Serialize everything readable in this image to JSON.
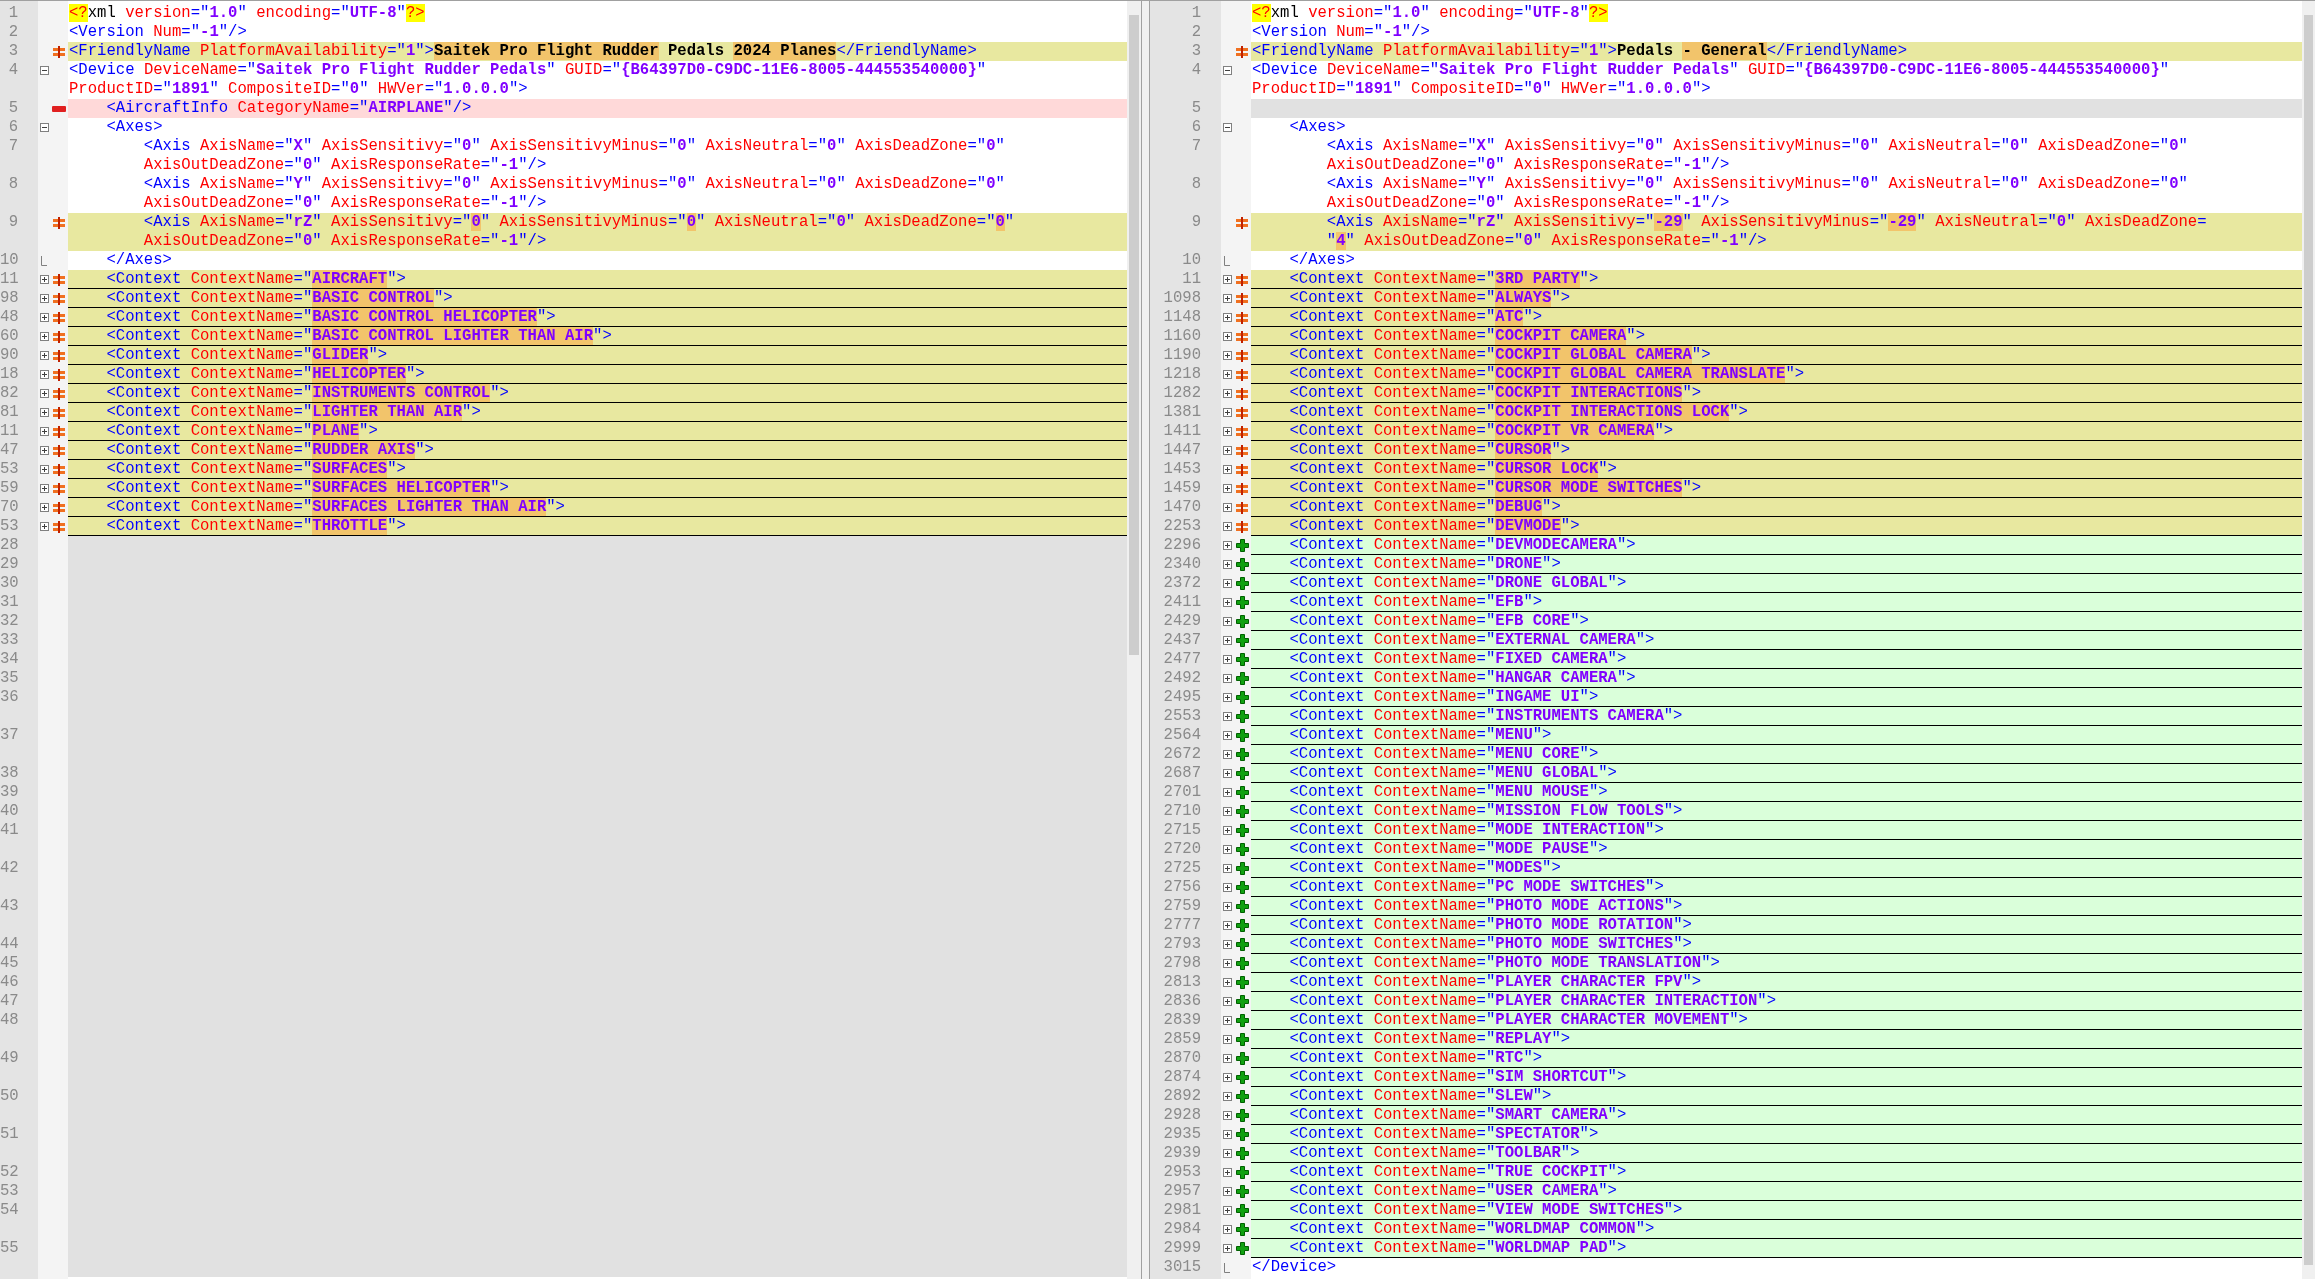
{
  "left_pane": {
    "lines": [
      {
        "number": "1",
        "visual_lines": [
          {
            "parts": [
              "<?xml version=\"1.0\" encoding=\"UTF-8\"?>"
            ]
          }
        ]
      },
      {
        "number": "2",
        "visual_lines": [
          {
            "parts": [
              "<Version Num=\"-1\"/>"
            ]
          }
        ]
      },
      {
        "number": "3",
        "kind": "changed",
        "visual_lines": [
          {
            "parts": [
              "<FriendlyName PlatformAvailability=\"1\">",
              {
                "text": "Saitek Pro Flight Rudder",
                "changed": true
              },
              " Pedals ",
              {
                "text": "2024 Planes",
                "changed": true
              },
              "</FriendlyName>"
            ]
          }
        ]
      },
      {
        "number": "4",
        "expanded": true,
        "visual_lines": [
          {
            "parts": [
              "<Device DeviceName=\"Saitek Pro Flight Rudder Pedals\" GUID=\"{B64397D0-C9DC-11E6-8005-444553540000}\""
            ]
          },
          {
            "parts": [
              "ProductID=\"1891\" CompositeID=\"0\" HWVer=\"1.0.0.0\">"
            ]
          }
        ],
        "children": [
          {
            "number": "5",
            "kind": "removed",
            "visual_lines": [
              {
                "parts": [
                  "<AircraftInfo CategoryName=\"AIRPLANE\"/>"
                ]
              }
            ]
          },
          {
            "number": "6",
            "expanded": true,
            "visual_lines": [
              {
                "parts": [
                  "<Axes>"
                ]
              }
            ],
            "children": [
              {
                "number": "7",
                "visual_lines": [
                  {
                    "parts": [
                      "<Axis AxisName=\"X\" AxisSensitivy=\"0\" AxisSensitivyMinus=\"0\" AxisNeutral=\"0\" AxisDeadZone=\"0\""
                    ]
                  },
                  {
                    "parts": [
                      "AxisOutDeadZone=\"0\" AxisResponseRate=\"-1\"/>"
                    ]
                  }
                ]
              },
              {
                "number": "8",
                "visual_lines": [
                  {
                    "parts": [
                      "<Axis AxisName=\"Y\" AxisSensitivy=\"0\" AxisSensitivyMinus=\"0\" AxisNeutral=\"0\" AxisDeadZone=\"0\""
                    ]
                  },
                  {
                    "parts": [
                      "AxisOutDeadZone=\"0\" AxisResponseRate=\"-1\"/>"
                    ]
                  }
                ]
              },
              {
                "number": "9",
                "kind": "changed",
                "visual_lines": [
                  {
                    "parts": [
                      "<Axis AxisName=\"rZ\" AxisSensitivy=\"",
                      {
                        "text": "0",
                        "changed": true
                      },
                      "\" AxisSensitivyMinus=\"",
                      {
                        "text": "0",
                        "changed": true
                      },
                      "\" AxisNeutral=\"0\" AxisDeadZone=\"",
                      {
                        "text": "0",
                        "changed": true
                      },
                      "\""
                    ]
                  },
                  {
                    "parts": [
                      "AxisOutDeadZone=\"0\" AxisResponseRate=\"-1\"/>"
                    ]
                  }
                ]
              }
            ],
            "closing": {
              "number": "10",
              "visual_lines": [
                {
                  "parts": [
                    "</Axes>"
                  ]
                }
              ]
            }
          },
          {
            "number": "11",
            "kind": "changed",
            "expanded": false,
            "visual_lines": [
              {
                "parts": [
                  "<Context ContextName=\"",
                  {
                    "text": "AIRCRAFT",
                    "changed": true
                  },
                  "\">"
                ]
              }
            ]
          },
          {
            "number": "98",
            "kind": "changed",
            "expanded": false,
            "visual_lines": [
              {
                "parts": [
                  "<Context ContextName=\"",
                  {
                    "text": "BASIC CONTROL",
                    "changed": true
                  },
                  "\">"
                ]
              }
            ]
          },
          {
            "number": "48",
            "kind": "changed",
            "expanded": false,
            "visual_lines": [
              {
                "parts": [
                  "<Context ContextName=\"",
                  {
                    "text": "BASIC CONTROL HELICOPTER",
                    "changed": true
                  },
                  "\">"
                ]
              }
            ]
          },
          {
            "number": "60",
            "kind": "changed",
            "expanded": false,
            "visual_lines": [
              {
                "parts": [
                  "<Context ContextName=\"",
                  {
                    "text": "BASIC CONTROL LIGHTER THAN AIR",
                    "changed": true
                  },
                  "\">"
                ]
              }
            ]
          },
          {
            "number": "90",
            "kind": "changed",
            "expanded": false,
            "visual_lines": [
              {
                "parts": [
                  "<Context ContextName=\"",
                  {
                    "text": "GLIDER",
                    "changed": true
                  },
                  "\">"
                ]
              }
            ]
          },
          {
            "number": "18",
            "kind": "changed",
            "expanded": false,
            "visual_lines": [
              {
                "parts": [
                  "<Context ContextName=\"",
                  {
                    "text": "HELICOPTER",
                    "changed": true
                  },
                  "\">"
                ]
              }
            ]
          },
          {
            "number": "82",
            "kind": "changed",
            "expanded": false,
            "visual_lines": [
              {
                "parts": [
                  "<Context ContextName=\"",
                  {
                    "text": "INSTRUMENTS CONTROL",
                    "changed": true
                  },
                  "\">"
                ]
              }
            ]
          },
          {
            "number": "81",
            "kind": "changed",
            "expanded": false,
            "visual_lines": [
              {
                "parts": [
                  "<Context ContextName=\"",
                  {
                    "text": "LIGHTER THAN AIR",
                    "changed": true
                  },
                  "\">"
                ]
              }
            ]
          },
          {
            "number": "11",
            "kind": "changed",
            "expanded": false,
            "visual_lines": [
              {
                "parts": [
                  "<Context ContextName=\"",
                  {
                    "text": "PLANE",
                    "changed": true
                  },
                  "\">"
                ]
              }
            ]
          },
          {
            "number": "47",
            "kind": "changed",
            "expanded": false,
            "visual_lines": [
              {
                "parts": [
                  "<Context ContextName=\"",
                  {
                    "text": "RUDDER AXIS",
                    "changed": true
                  },
                  "\">"
                ]
              }
            ]
          },
          {
            "number": "53",
            "kind": "changed",
            "expanded": false,
            "visual_lines": [
              {
                "parts": [
                  "<Context ContextName=\"",
                  {
                    "text": "SURFACES",
                    "changed": true
                  },
                  "\">"
                ]
              }
            ]
          },
          {
            "number": "59",
            "kind": "changed",
            "expanded": false,
            "visual_lines": [
              {
                "parts": [
                  "<Context ContextName=\"",
                  {
                    "text": "SURFACES HELICOPTER",
                    "changed": true
                  },
                  "\">"
                ]
              }
            ]
          },
          {
            "number": "70",
            "kind": "changed",
            "expanded": false,
            "visual_lines": [
              {
                "parts": [
                  "<Context ContextName=\"",
                  {
                    "text": "SURFACES LIGHTER THAN AIR",
                    "changed": true
                  },
                  "\">"
                ]
              }
            ]
          },
          {
            "number": "53",
            "kind": "changed",
            "expanded": false,
            "visual_lines": [
              {
                "parts": [
                  "<Context ContextName=\"",
                  {
                    "text": "THROTTLE",
                    "changed": true
                  },
                  "\">"
                ]
              }
            ]
          },
          {
            "number": "28",
            "kind": "blank"
          },
          {
            "number": "29",
            "kind": "blank"
          },
          {
            "number": "30",
            "kind": "blank"
          },
          {
            "number": "31",
            "kind": "blank"
          },
          {
            "number": "32",
            "kind": "blank"
          },
          {
            "number": "33",
            "kind": "blank"
          },
          {
            "number": "34",
            "kind": "blank"
          },
          {
            "number": "35",
            "kind": "blank"
          },
          {
            "number": "36",
            "kind": "blank"
          },
          {
            "kind": "blank"
          },
          {
            "number": "37",
            "kind": "blank"
          },
          {
            "kind": "blank"
          },
          {
            "number": "38",
            "kind": "blank"
          },
          {
            "number": "39",
            "kind": "blank"
          },
          {
            "number": "40",
            "kind": "blank"
          },
          {
            "number": "41",
            "kind": "blank"
          },
          {
            "kind": "blank"
          },
          {
            "number": "42",
            "kind": "blank"
          },
          {
            "kind": "blank"
          },
          {
            "number": "43",
            "kind": "blank"
          },
          {
            "kind": "blank"
          },
          {
            "number": "44",
            "kind": "blank"
          },
          {
            "number": "45",
            "kind": "blank"
          },
          {
            "number": "46",
            "kind": "blank"
          },
          {
            "number": "47",
            "kind": "blank"
          },
          {
            "number": "48",
            "kind": "blank"
          },
          {
            "kind": "blank"
          },
          {
            "number": "49",
            "kind": "blank"
          },
          {
            "kind": "blank"
          },
          {
            "number": "50",
            "kind": "blank"
          },
          {
            "kind": "blank"
          },
          {
            "number": "51",
            "kind": "blank"
          },
          {
            "kind": "blank"
          },
          {
            "number": "52",
            "kind": "blank"
          },
          {
            "number": "53",
            "kind": "blank"
          },
          {
            "number": "54",
            "kind": "blank"
          },
          {
            "kind": "blank"
          },
          {
            "number": "55",
            "kind": "blank"
          },
          {
            "kind": "blank"
          }
        ]
      }
    ]
  },
  "right_pane": {
    "lines": [
      {
        "number": "1",
        "visual_lines": [
          {
            "parts": [
              "<?xml version=\"1.0\" encoding=\"UTF-8\"?>"
            ]
          }
        ]
      },
      {
        "number": "2",
        "visual_lines": [
          {
            "parts": [
              "<Version Num=\"-1\"/>"
            ]
          }
        ]
      },
      {
        "number": "3",
        "kind": "changed",
        "visual_lines": [
          {
            "parts": [
              "<FriendlyName PlatformAvailability=\"1\">Pedals ",
              {
                "text": "- General",
                "changed": true
              },
              "</FriendlyName>"
            ]
          }
        ]
      },
      {
        "number": "4",
        "expanded": true,
        "visual_lines": [
          {
            "parts": [
              "<Device DeviceName=\"Saitek Pro Flight Rudder Pedals\" GUID=\"{B64397D0-C9DC-11E6-8005-444553540000}\""
            ]
          },
          {
            "parts": [
              "ProductID=\"1891\" CompositeID=\"0\" HWVer=\"1.0.0.0\">"
            ]
          }
        ],
        "children": [
          {
            "number": "5",
            "kind": "blank"
          },
          {
            "number": "6",
            "expanded": true,
            "visual_lines": [
              {
                "parts": [
                  "<Axes>"
                ]
              }
            ],
            "children": [
              {
                "number": "7",
                "visual_lines": [
                  {
                    "parts": [
                      "<Axis AxisName=\"X\" AxisSensitivy=\"0\" AxisSensitivyMinus=\"0\" AxisNeutral=\"0\" AxisDeadZone=\"0\""
                    ]
                  },
                  {
                    "parts": [
                      "AxisOutDeadZone=\"0\" AxisResponseRate=\"-1\"/>"
                    ]
                  }
                ]
              },
              {
                "number": "8",
                "visual_lines": [
                  {
                    "parts": [
                      "<Axis AxisName=\"Y\" AxisSensitivy=\"0\" AxisSensitivyMinus=\"0\" AxisNeutral=\"0\" AxisDeadZone=\"0\""
                    ]
                  },
                  {
                    "parts": [
                      "AxisOutDeadZone=\"0\" AxisResponseRate=\"-1\"/>"
                    ]
                  }
                ]
              },
              {
                "number": "9",
                "kind": "changed",
                "visual_lines": [
                  {
                    "parts": [
                      "<Axis AxisName=\"rZ\" AxisSensitivy=\"",
                      {
                        "text": "-29",
                        "changed": true
                      },
                      "\" AxisSensitivyMinus=\"",
                      {
                        "text": "-29",
                        "changed": true
                      },
                      "\" AxisNeutral=\"0\" AxisDeadZone="
                    ]
                  },
                  {
                    "parts": [
                      "\"",
                      {
                        "text": "4",
                        "changed": true
                      },
                      "\" AxisOutDeadZone=\"0\" AxisResponseRate=\"-1\"/>"
                    ]
                  }
                ]
              }
            ],
            "closing": {
              "number": "10",
              "visual_lines": [
                {
                  "parts": [
                    "</Axes>"
                  ]
                }
              ]
            }
          },
          {
            "number": "11",
            "kind": "changed",
            "expanded": false,
            "visual_lines": [
              {
                "parts": [
                  "<Context ContextName=\"",
                  {
                    "text": "3RD PARTY",
                    "changed": true
                  },
                  "\">"
                ]
              }
            ]
          },
          {
            "number": "1098",
            "kind": "changed",
            "expanded": false,
            "visual_lines": [
              {
                "parts": [
                  "<Context ContextName=\"",
                  {
                    "text": "ALWAYS",
                    "changed": true
                  },
                  "\">"
                ]
              }
            ]
          },
          {
            "number": "1148",
            "kind": "changed",
            "expanded": false,
            "visual_lines": [
              {
                "parts": [
                  "<Context ContextName=\"",
                  {
                    "text": "ATC",
                    "changed": true
                  },
                  "\">"
                ]
              }
            ]
          },
          {
            "number": "1160",
            "kind": "changed",
            "expanded": false,
            "visual_lines": [
              {
                "parts": [
                  "<Context ContextName=\"",
                  {
                    "text": "COCKPIT CAMERA",
                    "changed": true
                  },
                  "\">"
                ]
              }
            ]
          },
          {
            "number": "1190",
            "kind": "changed",
            "expanded": false,
            "visual_lines": [
              {
                "parts": [
                  "<Context ContextName=\"",
                  {
                    "text": "COCKPIT GLOBAL CAMERA",
                    "changed": true
                  },
                  "\">"
                ]
              }
            ]
          },
          {
            "number": "1218",
            "kind": "changed",
            "expanded": false,
            "visual_lines": [
              {
                "parts": [
                  "<Context ContextName=\"",
                  {
                    "text": "COCKPIT GLOBAL CAMERA TRANSLATE",
                    "changed": true
                  },
                  "\">"
                ]
              }
            ]
          },
          {
            "number": "1282",
            "kind": "changed",
            "expanded": false,
            "visual_lines": [
              {
                "parts": [
                  "<Context ContextName=\"",
                  {
                    "text": "COCKPIT INTERACTIONS",
                    "changed": true
                  },
                  "\">"
                ]
              }
            ]
          },
          {
            "number": "1381",
            "kind": "changed",
            "expanded": false,
            "visual_lines": [
              {
                "parts": [
                  "<Context ContextName=\"",
                  {
                    "text": "COCKPIT INTERACTIONS LOCK",
                    "changed": true
                  },
                  "\">"
                ]
              }
            ]
          },
          {
            "number": "1411",
            "kind": "changed",
            "expanded": false,
            "visual_lines": [
              {
                "parts": [
                  "<Context ContextName=\"",
                  {
                    "text": "COCKPIT VR CAMERA",
                    "changed": true
                  },
                  "\">"
                ]
              }
            ]
          },
          {
            "number": "1447",
            "kind": "changed",
            "expanded": false,
            "visual_lines": [
              {
                "parts": [
                  "<Context ContextName=\"",
                  {
                    "text": "CURSOR",
                    "changed": true
                  },
                  "\">"
                ]
              }
            ]
          },
          {
            "number": "1453",
            "kind": "changed",
            "expanded": false,
            "visual_lines": [
              {
                "parts": [
                  "<Context ContextName=\"",
                  {
                    "text": "CURSOR LOCK",
                    "changed": true
                  },
                  "\">"
                ]
              }
            ]
          },
          {
            "number": "1459",
            "kind": "changed",
            "expanded": false,
            "visual_lines": [
              {
                "parts": [
                  "<Context ContextName=\"",
                  {
                    "text": "CURSOR MODE SWITCHES",
                    "changed": true
                  },
                  "\">"
                ]
              }
            ]
          },
          {
            "number": "1470",
            "kind": "changed",
            "expanded": false,
            "visual_lines": [
              {
                "parts": [
                  "<Context ContextName=\"",
                  {
                    "text": "DEBUG",
                    "changed": true
                  },
                  "\">"
                ]
              }
            ]
          },
          {
            "number": "2253",
            "kind": "changed",
            "expanded": false,
            "visual_lines": [
              {
                "parts": [
                  "<Context ContextName=\"",
                  {
                    "text": "DEVMODE",
                    "changed": true
                  },
                  "\">"
                ]
              }
            ]
          },
          {
            "number": "2296",
            "kind": "added",
            "expanded": false,
            "visual_lines": [
              {
                "parts": [
                  "<Context ContextName=\"DEVMODECAMERA\">"
                ]
              }
            ]
          },
          {
            "number": "2340",
            "kind": "added",
            "expanded": false,
            "visual_lines": [
              {
                "parts": [
                  "<Context ContextName=\"DRONE\">"
                ]
              }
            ]
          },
          {
            "number": "2372",
            "kind": "added",
            "expanded": false,
            "visual_lines": [
              {
                "parts": [
                  "<Context ContextName=\"DRONE GLOBAL\">"
                ]
              }
            ]
          },
          {
            "number": "2411",
            "kind": "added",
            "expanded": false,
            "visual_lines": [
              {
                "parts": [
                  "<Context ContextName=\"EFB\">"
                ]
              }
            ]
          },
          {
            "number": "2429",
            "kind": "added",
            "expanded": false,
            "visual_lines": [
              {
                "parts": [
                  "<Context ContextName=\"EFB CORE\">"
                ]
              }
            ]
          },
          {
            "number": "2437",
            "kind": "added",
            "expanded": false,
            "visual_lines": [
              {
                "parts": [
                  "<Context ContextName=\"EXTERNAL CAMERA\">"
                ]
              }
            ]
          },
          {
            "number": "2477",
            "kind": "added",
            "expanded": false,
            "visual_lines": [
              {
                "parts": [
                  "<Context ContextName=\"FIXED CAMERA\">"
                ]
              }
            ]
          },
          {
            "number": "2492",
            "kind": "added",
            "expanded": false,
            "visual_lines": [
              {
                "parts": [
                  "<Context ContextName=\"HANGAR CAMERA\">"
                ]
              }
            ]
          },
          {
            "number": "2495",
            "kind": "added",
            "expanded": false,
            "visual_lines": [
              {
                "parts": [
                  "<Context ContextName=\"INGAME UI\">"
                ]
              }
            ]
          },
          {
            "number": "2553",
            "kind": "added",
            "expanded": false,
            "visual_lines": [
              {
                "parts": [
                  "<Context ContextName=\"INSTRUMENTS CAMERA\">"
                ]
              }
            ]
          },
          {
            "number": "2564",
            "kind": "added",
            "expanded": false,
            "visual_lines": [
              {
                "parts": [
                  "<Context ContextName=\"MENU\">"
                ]
              }
            ]
          },
          {
            "number": "2672",
            "kind": "added",
            "expanded": false,
            "visual_lines": [
              {
                "parts": [
                  "<Context ContextName=\"MENU CORE\">"
                ]
              }
            ]
          },
          {
            "number": "2687",
            "kind": "added",
            "expanded": false,
            "visual_lines": [
              {
                "parts": [
                  "<Context ContextName=\"MENU GLOBAL\">"
                ]
              }
            ]
          },
          {
            "number": "2701",
            "kind": "added",
            "expanded": false,
            "visual_lines": [
              {
                "parts": [
                  "<Context ContextName=\"MENU MOUSE\">"
                ]
              }
            ]
          },
          {
            "number": "2710",
            "kind": "added",
            "expanded": false,
            "visual_lines": [
              {
                "parts": [
                  "<Context ContextName=\"MISSION FLOW TOOLS\">"
                ]
              }
            ]
          },
          {
            "number": "2715",
            "kind": "added",
            "expanded": false,
            "visual_lines": [
              {
                "parts": [
                  "<Context ContextName=\"MODE INTERACTION\">"
                ]
              }
            ]
          },
          {
            "number": "2720",
            "kind": "added",
            "expanded": false,
            "visual_lines": [
              {
                "parts": [
                  "<Context ContextName=\"MODE PAUSE\">"
                ]
              }
            ]
          },
          {
            "number": "2725",
            "kind": "added",
            "expanded": false,
            "visual_lines": [
              {
                "parts": [
                  "<Context ContextName=\"MODES\">"
                ]
              }
            ]
          },
          {
            "number": "2756",
            "kind": "added",
            "expanded": false,
            "visual_lines": [
              {
                "parts": [
                  "<Context ContextName=\"PC MODE SWITCHES\">"
                ]
              }
            ]
          },
          {
            "number": "2759",
            "kind": "added",
            "expanded": false,
            "visual_lines": [
              {
                "parts": [
                  "<Context ContextName=\"PHOTO MODE ACTIONS\">"
                ]
              }
            ]
          },
          {
            "number": "2777",
            "kind": "added",
            "expanded": false,
            "visual_lines": [
              {
                "parts": [
                  "<Context ContextName=\"PHOTO MODE ROTATION\">"
                ]
              }
            ]
          },
          {
            "number": "2793",
            "kind": "added",
            "expanded": false,
            "visual_lines": [
              {
                "parts": [
                  "<Context ContextName=\"PHOTO MODE SWITCHES\">"
                ]
              }
            ]
          },
          {
            "number": "2798",
            "kind": "added",
            "expanded": false,
            "visual_lines": [
              {
                "parts": [
                  "<Context ContextName=\"PHOTO MODE TRANSLATION\">"
                ]
              }
            ]
          },
          {
            "number": "2813",
            "kind": "added",
            "expanded": false,
            "visual_lines": [
              {
                "parts": [
                  "<Context ContextName=\"PLAYER CHARACTER FPV\">"
                ]
              }
            ]
          },
          {
            "number": "2836",
            "kind": "added",
            "expanded": false,
            "visual_lines": [
              {
                "parts": [
                  "<Context ContextName=\"PLAYER CHARACTER INTERACTION\">"
                ]
              }
            ]
          },
          {
            "number": "2839",
            "kind": "added",
            "expanded": false,
            "visual_lines": [
              {
                "parts": [
                  "<Context ContextName=\"PLAYER CHARACTER MOVEMENT\">"
                ]
              }
            ]
          },
          {
            "number": "2859",
            "kind": "added",
            "expanded": false,
            "visual_lines": [
              {
                "parts": [
                  "<Context ContextName=\"REPLAY\">"
                ]
              }
            ]
          },
          {
            "number": "2870",
            "kind": "added",
            "expanded": false,
            "visual_lines": [
              {
                "parts": [
                  "<Context ContextName=\"RTC\">"
                ]
              }
            ]
          },
          {
            "number": "2874",
            "kind": "added",
            "expanded": false,
            "visual_lines": [
              {
                "parts": [
                  "<Context ContextName=\"SIM SHORTCUT\">"
                ]
              }
            ]
          },
          {
            "number": "2892",
            "kind": "added",
            "expanded": false,
            "visual_lines": [
              {
                "parts": [
                  "<Context ContextName=\"SLEW\">"
                ]
              }
            ]
          },
          {
            "number": "2928",
            "kind": "added",
            "expanded": false,
            "visual_lines": [
              {
                "parts": [
                  "<Context ContextName=\"SMART CAMERA\">"
                ]
              }
            ]
          },
          {
            "number": "2935",
            "kind": "added",
            "expanded": false,
            "visual_lines": [
              {
                "parts": [
                  "<Context ContextName=\"SPECTATOR\">"
                ]
              }
            ]
          },
          {
            "number": "2939",
            "kind": "added",
            "expanded": false,
            "visual_lines": [
              {
                "parts": [
                  "<Context ContextName=\"TOOLBAR\">"
                ]
              }
            ]
          },
          {
            "number": "2953",
            "kind": "added",
            "expanded": false,
            "visual_lines": [
              {
                "parts": [
                  "<Context ContextName=\"TRUE COCKPIT\">"
                ]
              }
            ]
          },
          {
            "number": "2957",
            "kind": "added",
            "expanded": false,
            "visual_lines": [
              {
                "parts": [
                  "<Context ContextName=\"USER CAMERA\">"
                ]
              }
            ]
          },
          {
            "number": "2981",
            "kind": "added",
            "expanded": false,
            "visual_lines": [
              {
                "parts": [
                  "<Context ContextName=\"VIEW MODE SWITCHES\">"
                ]
              }
            ]
          },
          {
            "number": "2984",
            "kind": "added",
            "expanded": false,
            "visual_lines": [
              {
                "parts": [
                  "<Context ContextName=\"WORLDMAP COMMON\">"
                ]
              }
            ]
          },
          {
            "number": "2999",
            "kind": "added",
            "expanded": false,
            "visual_lines": [
              {
                "parts": [
                  "<Context ContextName=\"WORLDMAP PAD\">"
                ]
              }
            ]
          }
        ],
        "closing": {
          "number": "3015",
          "visual_lines": [
            {
              "parts": [
                "</Device>"
              ]
            }
          ]
        }
      }
    ]
  }
}
